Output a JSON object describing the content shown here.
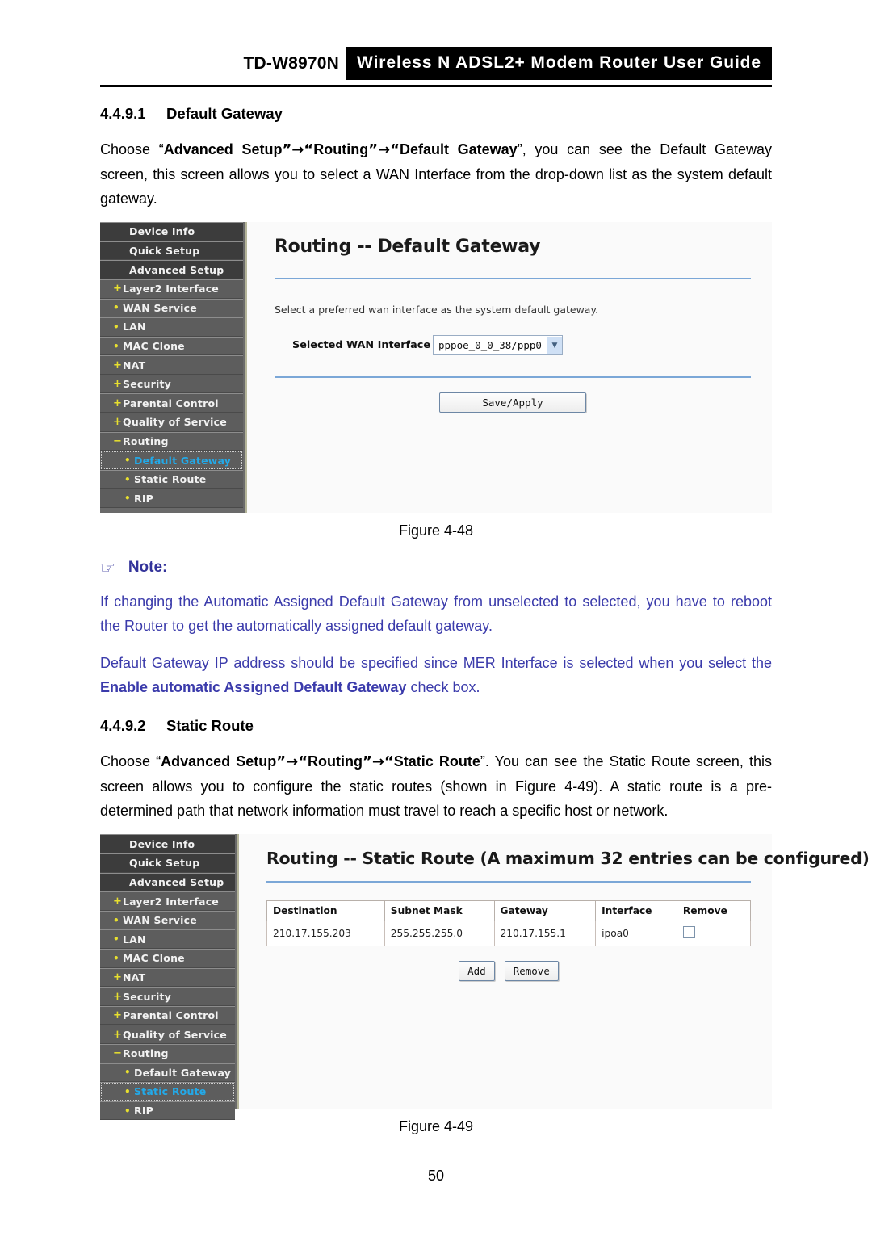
{
  "header": {
    "model": "TD-W8970N",
    "banner": "Wireless N ADSL2+ Modem Router User Guide"
  },
  "sections": [
    {
      "number": "4.4.9.1",
      "title": "Default Gateway",
      "paragraph_parts": {
        "p1": "Choose “",
        "b1": "Advanced Setup",
        "p2": "”→“",
        "b2": "Routing",
        "p3": "”→“",
        "b3": "Default Gateway",
        "p4": "”, you can see the Default Gateway screen, this screen allows you to select a WAN Interface from the drop-down list as the system default gateway."
      }
    },
    {
      "number": "4.4.9.2",
      "title": "Static Route",
      "paragraph_parts": {
        "p1": "Choose “",
        "b1": "Advanced Setup",
        "p2": "”→“",
        "b2": "Routing",
        "p3": "”→“",
        "b3": "Static Route",
        "p4": "”. You can see the Static Route screen, this screen allows you to configure the static routes (shown in Figure 4-49). A static route is a pre-determined path that network information must travel to reach a specific host or network."
      }
    }
  ],
  "figure1": {
    "caption": "Figure 4-48",
    "sidebar": [
      {
        "label": "Device Info",
        "level": "top",
        "mark": "",
        "selected": false
      },
      {
        "label": "Quick Setup",
        "level": "top",
        "mark": "",
        "selected": false
      },
      {
        "label": "Advanced Setup",
        "level": "top",
        "mark": "",
        "selected": false
      },
      {
        "label": "Layer2 Interface",
        "level": "lvl1",
        "mark": "+",
        "selected": false
      },
      {
        "label": "WAN Service",
        "level": "lvl1",
        "mark": "•",
        "selected": false
      },
      {
        "label": "LAN",
        "level": "lvl1",
        "mark": "•",
        "selected": false
      },
      {
        "label": "MAC Clone",
        "level": "lvl1",
        "mark": "•",
        "selected": false
      },
      {
        "label": "NAT",
        "level": "lvl1",
        "mark": "+",
        "selected": false
      },
      {
        "label": "Security",
        "level": "lvl1",
        "mark": "+",
        "selected": false
      },
      {
        "label": "Parental Control",
        "level": "lvl1",
        "mark": "+",
        "selected": false
      },
      {
        "label": "Quality of Service",
        "level": "lvl1",
        "mark": "+",
        "selected": false
      },
      {
        "label": "Routing",
        "level": "lvl1",
        "mark": "−",
        "selected": false
      },
      {
        "label": "Default Gateway",
        "level": "lvl2",
        "mark": "•",
        "selected": true
      },
      {
        "label": "Static Route",
        "level": "lvl2",
        "mark": "•",
        "selected": false
      },
      {
        "label": "RIP",
        "level": "lvl2",
        "mark": "•",
        "selected": false
      }
    ],
    "panel": {
      "title": "Routing -- Default Gateway",
      "description": "Select a preferred wan interface as the system default gateway.",
      "field_label": "Selected WAN Interface",
      "field_value": "pppoe_0_0_38/ppp0",
      "dropdown_arrow": "▼",
      "save_button": "Save/Apply"
    }
  },
  "note": {
    "hand_icon": "☞",
    "title": "Note:",
    "paragraph1": "If changing the Automatic Assigned Default Gateway from unselected to selected, you have to reboot the Router to get the automatically assigned default gateway.",
    "paragraph2_pre": "Default Gateway IP address should be specified since MER Interface is selected when you select the ",
    "paragraph2_bold": "Enable automatic Assigned Default Gateway",
    "paragraph2_post": " check box."
  },
  "figure2": {
    "caption": "Figure 4-49",
    "sidebar": [
      {
        "label": "Device Info",
        "level": "top",
        "mark": "",
        "selected": false
      },
      {
        "label": "Quick Setup",
        "level": "top",
        "mark": "",
        "selected": false
      },
      {
        "label": "Advanced Setup",
        "level": "top",
        "mark": "",
        "selected": false
      },
      {
        "label": "Layer2 Interface",
        "level": "lvl1",
        "mark": "+",
        "selected": false
      },
      {
        "label": "WAN Service",
        "level": "lvl1",
        "mark": "•",
        "selected": false
      },
      {
        "label": "LAN",
        "level": "lvl1",
        "mark": "•",
        "selected": false
      },
      {
        "label": "MAC Clone",
        "level": "lvl1",
        "mark": "•",
        "selected": false
      },
      {
        "label": "NAT",
        "level": "lvl1",
        "mark": "+",
        "selected": false
      },
      {
        "label": "Security",
        "level": "lvl1",
        "mark": "+",
        "selected": false
      },
      {
        "label": "Parental Control",
        "level": "lvl1",
        "mark": "+",
        "selected": false
      },
      {
        "label": "Quality of Service",
        "level": "lvl1",
        "mark": "+",
        "selected": false
      },
      {
        "label": "Routing",
        "level": "lvl1",
        "mark": "−",
        "selected": false
      },
      {
        "label": "Default Gateway",
        "level": "lvl2",
        "mark": "•",
        "selected": false
      },
      {
        "label": "Static Route",
        "level": "lvl2",
        "mark": "•",
        "selected": true
      },
      {
        "label": "RIP",
        "level": "lvl2",
        "mark": "•",
        "selected": false
      }
    ],
    "panel": {
      "title": "Routing -- Static Route (A maximum 32 entries can be configured)",
      "table": {
        "columns": [
          "Destination",
          "Subnet Mask",
          "Gateway",
          "Interface",
          "Remove"
        ],
        "rows": [
          {
            "destination": "210.17.155.203",
            "subnet_mask": "255.255.255.0",
            "gateway": "210.17.155.1",
            "interface": "ipoa0",
            "remove_checked": false
          }
        ]
      },
      "add_button": "Add",
      "remove_button": "Remove"
    }
  },
  "page_number": "50"
}
